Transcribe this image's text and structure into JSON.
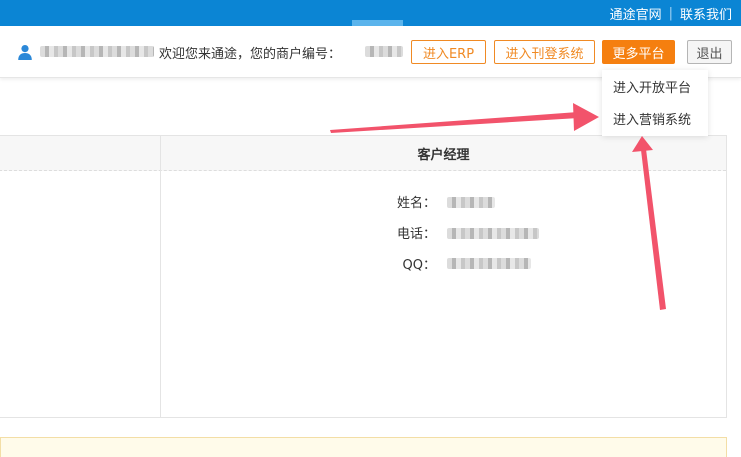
{
  "topbar": {
    "links": [
      {
        "label": "通途官网"
      },
      {
        "label": "联系我们"
      }
    ],
    "separator": "|"
  },
  "header": {
    "welcome_text": "欢迎您来通途，您的商户编号：",
    "buttons": {
      "erp": "进入ERP",
      "listing": "进入刊登系统",
      "more": "更多平台",
      "logout": "退出"
    }
  },
  "dropdown": {
    "items": [
      {
        "label": "进入开放平台"
      },
      {
        "label": "进入营销系统"
      }
    ]
  },
  "table": {
    "header": "客户经理",
    "fields": {
      "name_label": "姓名：",
      "phone_label": "电话：",
      "qq_label": "QQ："
    }
  },
  "colors": {
    "topbar_blue": "#0b85d4",
    "accent_orange": "#f08a24",
    "more_button_orange": "#f57f0f",
    "annotation_arrow": "#f2536b"
  },
  "icons": {
    "user": "user-icon"
  }
}
